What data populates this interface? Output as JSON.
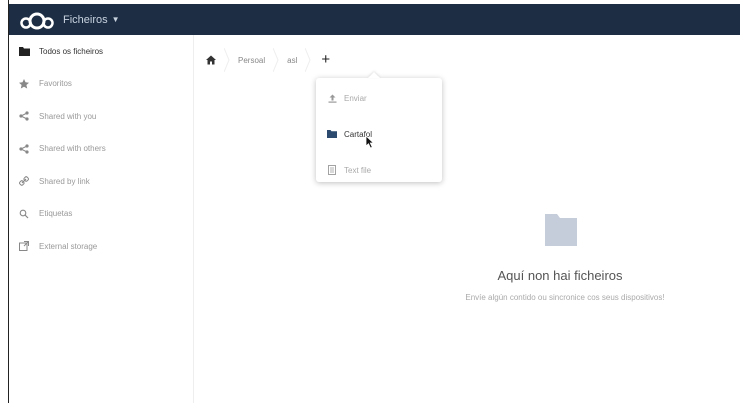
{
  "header": {
    "app_name": "Ficheiros",
    "logo_icon": "cloud-logo-icon",
    "background_color": "#1d2d44"
  },
  "sidebar": {
    "items": [
      {
        "label": "Todos os ficheiros",
        "icon": "folder-icon",
        "active": true
      },
      {
        "label": "Favoritos",
        "icon": "star-icon",
        "active": false
      },
      {
        "label": "Shared with you",
        "icon": "share-icon",
        "active": false
      },
      {
        "label": "Shared with others",
        "icon": "share-icon",
        "active": false
      },
      {
        "label": "Shared by link",
        "icon": "link-icon",
        "active": false
      },
      {
        "label": "Etiquetas",
        "icon": "tag-icon",
        "active": false
      },
      {
        "label": "External storage",
        "icon": "external-storage-icon",
        "active": false
      }
    ]
  },
  "breadcrumb": {
    "items": [
      "Persoal",
      "asl"
    ],
    "home_icon": "home-icon",
    "add_icon": "plus-icon"
  },
  "new_menu": {
    "items": [
      {
        "label": "Enviar",
        "icon": "upload-icon"
      },
      {
        "label": "Cartafol",
        "icon": "folder-icon"
      },
      {
        "label": "Text file",
        "icon": "text-file-icon"
      }
    ]
  },
  "empty_state": {
    "title": "Aquí non hai ficheiros",
    "subtitle": "Envíe algún contido ou sincronice cos seus dispositivos!",
    "icon": "folder-icon",
    "icon_color": "#c5ccda"
  }
}
